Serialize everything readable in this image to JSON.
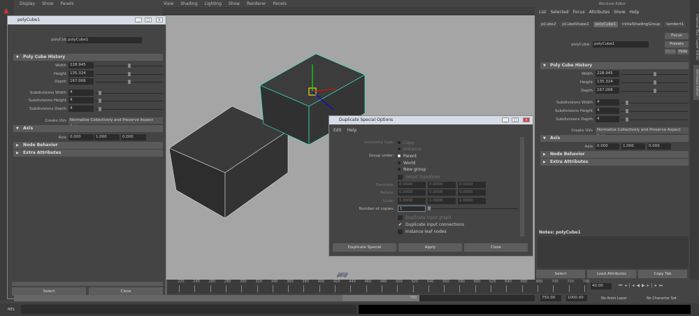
{
  "left_menu": [
    "Display",
    "Show",
    "Panels"
  ],
  "viewport": {
    "menu": [
      "View",
      "Shading",
      "Lighting",
      "Show",
      "Renderer",
      "Panels"
    ],
    "camera_label": "persp"
  },
  "poly_window": {
    "title": "polyCube1",
    "node_label": "polyCube:",
    "node_value": "polyCube1",
    "sections": {
      "history": "Poly Cube History",
      "axis": "Axis",
      "node_behavior": "Node Behavior",
      "extra": "Extra Attributes"
    },
    "fields": [
      {
        "label": "Width",
        "value": "228.945"
      },
      {
        "label": "Height",
        "value": "135.324"
      },
      {
        "label": "Depth",
        "value": "167.006"
      }
    ],
    "subdivs": [
      {
        "label": "Subdivisions Width",
        "value": "4"
      },
      {
        "label": "Subdivisions Height",
        "value": "4"
      },
      {
        "label": "Subdivisions Depth",
        "value": "4"
      }
    ],
    "create_uvs_label": "Create UVs",
    "create_uvs_value": "Normalize Collectively and Preserve Aspect Ratio",
    "axis_label": "Axis",
    "axis": [
      "0.000",
      "1.000",
      "0.000"
    ],
    "select": "Select",
    "close": "Close"
  },
  "duplicate": {
    "title": "Duplicate Special Options",
    "menu": [
      "Edit",
      "Help"
    ],
    "geometry_type_label": "Geometry type:",
    "geometry_options": [
      "Copy",
      "Instance"
    ],
    "group_under_label": "Group under:",
    "group_options": [
      "Parent",
      "World",
      "New group"
    ],
    "smart_transform": "Smart transform",
    "translate_label": "Translate:",
    "translate": [
      "0.0000",
      "0.0000",
      "0.0000"
    ],
    "rotate_label": "Rotate:",
    "rotate": [
      "0.0000",
      "0.0000",
      "0.0000"
    ],
    "scale_label": "Scale:",
    "scale": [
      "1.0000",
      "1.0000",
      "1.0000"
    ],
    "copies_label": "Number of copies:",
    "copies_value": "1",
    "dup_input_graph": "Duplicate input graph",
    "dup_input_conn": "Duplicate input connections",
    "instance_leaf": "Instance leaf nodes",
    "buttons": [
      "Duplicate Special",
      "Apply",
      "Close"
    ]
  },
  "attr_editor": {
    "title": "Attribute Editor",
    "menu": [
      "List",
      "Selected",
      "Focus",
      "Attributes",
      "Show",
      "Help"
    ],
    "tabs": [
      "pCube2",
      "pCubeShape2",
      "polyCube1",
      "initialShadingGroup",
      "lambert1"
    ],
    "focus": "Focus",
    "presets": "Presets",
    "show": "Show",
    "hide": "Hide",
    "notes": "Notes:  polyCube1",
    "buttons": [
      "Select",
      "Load Attributes",
      "Copy Tab"
    ],
    "side_tabs": [
      "Channel Box / Layer Editor",
      "Attribute Editor"
    ]
  },
  "timeline": {
    "ticks": [
      "220",
      "240",
      "260",
      "280",
      "300",
      "320",
      "340",
      "360",
      "380",
      "400",
      "420",
      "440",
      "460",
      "480",
      "500",
      "520",
      "540",
      "560",
      "580",
      "600",
      "620",
      "640",
      "660",
      "680",
      "700",
      "720",
      "740"
    ],
    "current": "40.00",
    "range_value": "750",
    "start": "750.00",
    "end": "1000.00",
    "anim_layer": "No Anim Layer",
    "char_set": "No Character Set"
  },
  "cmdline": {
    "label": "MEL"
  }
}
